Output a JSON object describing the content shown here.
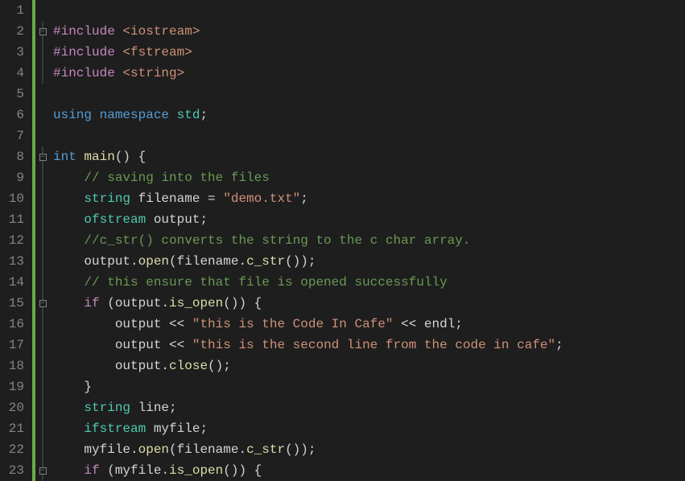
{
  "colors": {
    "background": "#1e1e1e",
    "gutter_text": "#858585",
    "margin_bar": "#6aa84f",
    "keyword_blue": "#569cd6",
    "keyword_purple": "#c586c0",
    "string": "#ce9178",
    "comment": "#6a9955",
    "type": "#4ec9b0",
    "function": "#dcdcaa",
    "default": "#d4d4d4"
  },
  "gutter": {
    "line_numbers": [
      "1",
      "2",
      "3",
      "4",
      "5",
      "6",
      "7",
      "8",
      "9",
      "10",
      "11",
      "12",
      "13",
      "14",
      "15",
      "16",
      "17",
      "18",
      "19",
      "20",
      "21",
      "22",
      "23"
    ]
  },
  "fold": {
    "markers": {
      "r2": "-",
      "r8": "-",
      "r15": "-",
      "r23": "-"
    }
  },
  "code": {
    "lines": [
      {
        "n": 1,
        "tokens": []
      },
      {
        "n": 2,
        "tokens": [
          {
            "t": "#include ",
            "c": "c-dir"
          },
          {
            "t": "<iostream>",
            "c": "c-hdr"
          }
        ]
      },
      {
        "n": 3,
        "tokens": [
          {
            "t": "#include ",
            "c": "c-dir"
          },
          {
            "t": "<fstream>",
            "c": "c-hdr"
          }
        ]
      },
      {
        "n": 4,
        "tokens": [
          {
            "t": "#include ",
            "c": "c-dir"
          },
          {
            "t": "<string>",
            "c": "c-hdr"
          }
        ]
      },
      {
        "n": 5,
        "tokens": []
      },
      {
        "n": 6,
        "tokens": [
          {
            "t": "using ",
            "c": "c-kw"
          },
          {
            "t": "namespace ",
            "c": "c-kw"
          },
          {
            "t": "std",
            "c": "c-ns"
          },
          {
            "t": ";",
            "c": "c-punc"
          }
        ]
      },
      {
        "n": 7,
        "tokens": []
      },
      {
        "n": 8,
        "tokens": [
          {
            "t": "int ",
            "c": "c-kw"
          },
          {
            "t": "main",
            "c": "c-fn"
          },
          {
            "t": "() {",
            "c": "c-punc"
          }
        ]
      },
      {
        "n": 9,
        "tokens": [
          {
            "t": "    ",
            "c": ""
          },
          {
            "t": "// saving into the files",
            "c": "c-com"
          }
        ]
      },
      {
        "n": 10,
        "tokens": [
          {
            "t": "    ",
            "c": ""
          },
          {
            "t": "string ",
            "c": "c-type"
          },
          {
            "t": "filename ",
            "c": "c-ident"
          },
          {
            "t": "= ",
            "c": "c-punc"
          },
          {
            "t": "\"demo.txt\"",
            "c": "c-str"
          },
          {
            "t": ";",
            "c": "c-punc"
          }
        ]
      },
      {
        "n": 11,
        "tokens": [
          {
            "t": "    ",
            "c": ""
          },
          {
            "t": "ofstream ",
            "c": "c-type"
          },
          {
            "t": "output",
            "c": "c-ident"
          },
          {
            "t": ";",
            "c": "c-punc"
          }
        ]
      },
      {
        "n": 12,
        "tokens": [
          {
            "t": "    ",
            "c": ""
          },
          {
            "t": "//c_str() converts the string to the c char array.",
            "c": "c-com"
          }
        ]
      },
      {
        "n": 13,
        "tokens": [
          {
            "t": "    ",
            "c": ""
          },
          {
            "t": "output",
            "c": "c-ident"
          },
          {
            "t": ".",
            "c": "c-punc"
          },
          {
            "t": "open",
            "c": "c-fn"
          },
          {
            "t": "(",
            "c": "c-punc"
          },
          {
            "t": "filename",
            "c": "c-ident"
          },
          {
            "t": ".",
            "c": "c-punc"
          },
          {
            "t": "c_str",
            "c": "c-fn"
          },
          {
            "t": "());",
            "c": "c-punc"
          }
        ]
      },
      {
        "n": 14,
        "tokens": [
          {
            "t": "    ",
            "c": ""
          },
          {
            "t": "// this ensure that file is opened successfully",
            "c": "c-com"
          }
        ]
      },
      {
        "n": 15,
        "tokens": [
          {
            "t": "    ",
            "c": ""
          },
          {
            "t": "if ",
            "c": "c-kw2"
          },
          {
            "t": "(",
            "c": "c-punc"
          },
          {
            "t": "output",
            "c": "c-ident"
          },
          {
            "t": ".",
            "c": "c-punc"
          },
          {
            "t": "is_open",
            "c": "c-fn"
          },
          {
            "t": "()) {",
            "c": "c-punc"
          }
        ]
      },
      {
        "n": 16,
        "tokens": [
          {
            "t": "        ",
            "c": ""
          },
          {
            "t": "output ",
            "c": "c-ident"
          },
          {
            "t": "<< ",
            "c": "c-punc"
          },
          {
            "t": "\"this is the Code In Cafe\"",
            "c": "c-str"
          },
          {
            "t": " << ",
            "c": "c-punc"
          },
          {
            "t": "endl",
            "c": "c-ident"
          },
          {
            "t": ";",
            "c": "c-punc"
          }
        ]
      },
      {
        "n": 17,
        "tokens": [
          {
            "t": "        ",
            "c": ""
          },
          {
            "t": "output ",
            "c": "c-ident"
          },
          {
            "t": "<< ",
            "c": "c-punc"
          },
          {
            "t": "\"this is the second line from the code in cafe\"",
            "c": "c-str"
          },
          {
            "t": ";",
            "c": "c-punc"
          }
        ]
      },
      {
        "n": 18,
        "tokens": [
          {
            "t": "        ",
            "c": ""
          },
          {
            "t": "output",
            "c": "c-ident"
          },
          {
            "t": ".",
            "c": "c-punc"
          },
          {
            "t": "close",
            "c": "c-fn"
          },
          {
            "t": "();",
            "c": "c-punc"
          }
        ]
      },
      {
        "n": 19,
        "tokens": [
          {
            "t": "    }",
            "c": "c-punc"
          }
        ]
      },
      {
        "n": 20,
        "tokens": [
          {
            "t": "    ",
            "c": ""
          },
          {
            "t": "string ",
            "c": "c-type"
          },
          {
            "t": "line",
            "c": "c-ident"
          },
          {
            "t": ";",
            "c": "c-punc"
          }
        ]
      },
      {
        "n": 21,
        "tokens": [
          {
            "t": "    ",
            "c": ""
          },
          {
            "t": "ifstream ",
            "c": "c-type"
          },
          {
            "t": "myfile",
            "c": "c-ident"
          },
          {
            "t": ";",
            "c": "c-punc"
          }
        ]
      },
      {
        "n": 22,
        "tokens": [
          {
            "t": "    ",
            "c": ""
          },
          {
            "t": "myfile",
            "c": "c-ident"
          },
          {
            "t": ".",
            "c": "c-punc"
          },
          {
            "t": "open",
            "c": "c-fn"
          },
          {
            "t": "(",
            "c": "c-punc"
          },
          {
            "t": "filename",
            "c": "c-ident"
          },
          {
            "t": ".",
            "c": "c-punc"
          },
          {
            "t": "c_str",
            "c": "c-fn"
          },
          {
            "t": "());",
            "c": "c-punc"
          }
        ]
      },
      {
        "n": 23,
        "tokens": [
          {
            "t": "    ",
            "c": ""
          },
          {
            "t": "if ",
            "c": "c-kw2"
          },
          {
            "t": "(",
            "c": "c-punc"
          },
          {
            "t": "myfile",
            "c": "c-ident"
          },
          {
            "t": ".",
            "c": "c-punc"
          },
          {
            "t": "is_open",
            "c": "c-fn"
          },
          {
            "t": "()) {",
            "c": "c-punc"
          }
        ]
      }
    ]
  }
}
